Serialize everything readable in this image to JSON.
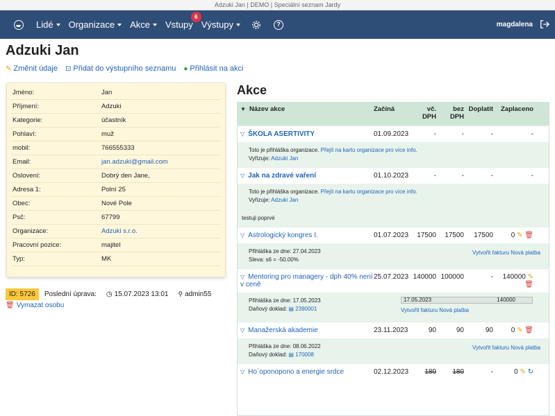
{
  "window_title": "Adzuki Jan | DEMO | Speciální seznam Jardy",
  "nav": {
    "items": [
      {
        "label": "Lidé",
        "dropdown": true
      },
      {
        "label": "Organizace",
        "dropdown": true
      },
      {
        "label": "Akce",
        "dropdown": true
      },
      {
        "label": "Vstupy",
        "dropdown": false,
        "badge": "6"
      },
      {
        "label": "Výstupy",
        "dropdown": true
      }
    ],
    "user": "magdalena"
  },
  "page": {
    "title": "Adzuki Jan",
    "actions": {
      "edit": "Změnit údaje",
      "add_to_list": "Přidat do výstupního seznamu",
      "register": "Přihlásit na akci"
    }
  },
  "person": {
    "fields": [
      {
        "label": "Jméno:",
        "value": "Jan"
      },
      {
        "label": "Příjmení:",
        "value": "Adzuki"
      },
      {
        "label": "Kategorie:",
        "value": "účastník"
      },
      {
        "label": "Pohlaví:",
        "value": "muž"
      },
      {
        "label": "mobil:",
        "value": "766555333"
      },
      {
        "label": "Email:",
        "value": "jan.adzuki@gmail.com",
        "link": true
      },
      {
        "label": "Oslovení:",
        "value": "Dobrý den Jane,"
      },
      {
        "label": "Adresa 1:",
        "value": "Polní 25"
      },
      {
        "label": "Obec:",
        "value": "Nové Pole"
      },
      {
        "label": "Psč:",
        "value": "67799"
      },
      {
        "label": "Organizace:",
        "value": "Adzuki s.r.o.",
        "link": true
      },
      {
        "label": "Pracovní pozice:",
        "value": "majitel"
      },
      {
        "label": "Typ:",
        "value": "MK"
      }
    ]
  },
  "meta": {
    "id": "ID: 5726",
    "last_edit_label": "Poslední úprava:",
    "last_edit_time": "15.07.2023 13:01",
    "last_edit_user": "admin55",
    "delete_label": "Vymazat osobu"
  },
  "akce": {
    "title": "Akce",
    "headers": {
      "name": "Název akce",
      "start": "Začíná",
      "vc_dph_1": "vč.",
      "vc_dph_2": "DPH",
      "bez_dph_1": "bez",
      "bez_dph_2": "DPH",
      "doplatit": "Doplatit",
      "zaplaceno": "Zaplaceno"
    },
    "rows": [
      {
        "name": "ŠKOLA ASERTIVITY",
        "bold": true,
        "start": "01.09.2023",
        "vc": "-",
        "bez": "-",
        "doplatit": "-",
        "zaplaceno": "-",
        "detail_1": "Toto je přihláška organizace.",
        "detail_link": "Přejít na kartu organizace pro více info.",
        "detail_2_label": "Vyřizuje:",
        "detail_2_value": "Adzuki Jan"
      },
      {
        "name": "Jak na zdravé vaření",
        "bold": true,
        "start": "01.10.2023",
        "vc": "-",
        "bez": "-",
        "doplatit": "-",
        "zaplaceno": "-",
        "detail_1": "Toto je přihláška organizace.",
        "detail_link": "Přejít na kartu organizace pro více info.",
        "detail_2_label": "Vyřizuje:",
        "detail_2_value": "Adzuki Jan",
        "note": "testuji poprvé"
      },
      {
        "name": "Astrologický kongres I.",
        "start": "01.07.2023",
        "vc": "17500",
        "bez": "17500",
        "doplatit": "17500",
        "zaplaceno": "0",
        "detail_1": "Přihláška ze dne: 27.04.2023",
        "detail_2_label": "Sleva: s6 = -50.00%",
        "right_1": "Vytvořit fakturu",
        "right_2": "Nová platba"
      },
      {
        "name": "Mentoring pro managery - dph 40% není v ceně",
        "start": "25.07.2023",
        "vc": "140000",
        "bez": "100000",
        "doplatit": "-",
        "zaplaceno": "140000",
        "detail_1": "Přihláška ze dne: 17.05.2023",
        "detail_2_label": "Daňový doklad:",
        "detail_2_value": "2390001",
        "pill_date": "17.05.2023",
        "pill_amount": "140000",
        "right_1": "Vytvořit fakturu",
        "right_2": "Nová platba"
      },
      {
        "name": "Manažerská akademie",
        "start": "23.11.2023",
        "vc": "90",
        "bez": "90",
        "doplatit": "90",
        "zaplaceno": "0",
        "detail_1": "Přihláška ze dne: 08.06.2022",
        "detail_2_label": "Daňový doklad:",
        "detail_2_value": "170008",
        "right_1": "Vytvořit fakturu",
        "right_2": "Nová platba"
      },
      {
        "name": "Ho´oponopono a energie srdce",
        "strike": true,
        "start": "02.12.2023",
        "vc": "180",
        "bez": "180",
        "doplatit": "-",
        "zaplaceno": "0"
      }
    ]
  }
}
